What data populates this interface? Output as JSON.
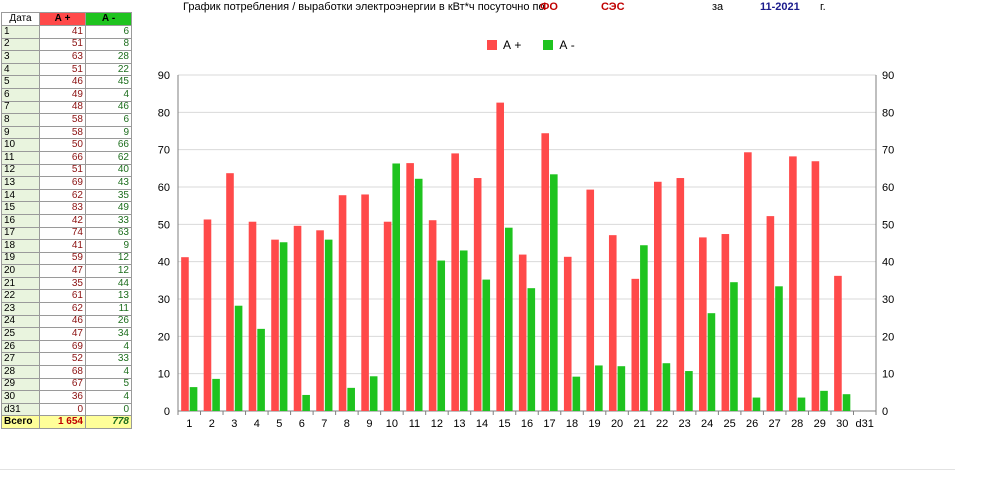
{
  "header": {
    "title": "График потребления / выработки электроэнергии в кВт*ч  посуточно по",
    "fo": "ФО",
    "ses": "СЭС",
    "za": "за",
    "period": "11-2021",
    "g": "г."
  },
  "table": {
    "headers": {
      "date": "Дата",
      "plus": "А +",
      "minus": "А -"
    },
    "rows": [
      {
        "date": "1",
        "plus": "41",
        "minus": "6"
      },
      {
        "date": "2",
        "plus": "51",
        "minus": "8"
      },
      {
        "date": "3",
        "plus": "63",
        "minus": "28"
      },
      {
        "date": "4",
        "plus": "51",
        "minus": "22"
      },
      {
        "date": "5",
        "plus": "46",
        "minus": "45"
      },
      {
        "date": "6",
        "plus": "49",
        "minus": "4"
      },
      {
        "date": "7",
        "plus": "48",
        "minus": "46"
      },
      {
        "date": "8",
        "plus": "58",
        "minus": "6"
      },
      {
        "date": "9",
        "plus": "58",
        "minus": "9"
      },
      {
        "date": "10",
        "plus": "50",
        "minus": "66"
      },
      {
        "date": "11",
        "plus": "66",
        "minus": "62"
      },
      {
        "date": "12",
        "plus": "51",
        "minus": "40"
      },
      {
        "date": "13",
        "plus": "69",
        "minus": "43"
      },
      {
        "date": "14",
        "plus": "62",
        "minus": "35"
      },
      {
        "date": "15",
        "plus": "83",
        "minus": "49"
      },
      {
        "date": "16",
        "plus": "42",
        "minus": "33"
      },
      {
        "date": "17",
        "plus": "74",
        "minus": "63"
      },
      {
        "date": "18",
        "plus": "41",
        "minus": "9"
      },
      {
        "date": "19",
        "plus": "59",
        "minus": "12"
      },
      {
        "date": "20",
        "plus": "47",
        "minus": "12"
      },
      {
        "date": "21",
        "plus": "35",
        "minus": "44"
      },
      {
        "date": "22",
        "plus": "61",
        "minus": "13"
      },
      {
        "date": "23",
        "plus": "62",
        "minus": "11"
      },
      {
        "date": "24",
        "plus": "46",
        "minus": "26"
      },
      {
        "date": "25",
        "plus": "47",
        "minus": "34"
      },
      {
        "date": "26",
        "plus": "69",
        "minus": "4"
      },
      {
        "date": "27",
        "plus": "52",
        "minus": "33"
      },
      {
        "date": "28",
        "plus": "68",
        "minus": "4"
      },
      {
        "date": "29",
        "plus": "67",
        "minus": "5"
      },
      {
        "date": "30",
        "plus": "36",
        "minus": "4"
      },
      {
        "date": "d31",
        "plus": "0",
        "minus": "0"
      }
    ],
    "total": {
      "date": "Всего",
      "plus": "1 654",
      "minus": "778"
    }
  },
  "colors": {
    "plus": "#ff4a4a",
    "minus": "#1fc31f",
    "grid": "#d9d9d9",
    "axis": "#7f7f7f"
  },
  "chart_data": {
    "type": "bar",
    "categories": [
      "1",
      "2",
      "3",
      "4",
      "5",
      "6",
      "7",
      "8",
      "9",
      "10",
      "11",
      "12",
      "13",
      "14",
      "15",
      "16",
      "17",
      "18",
      "19",
      "20",
      "21",
      "22",
      "23",
      "24",
      "25",
      "26",
      "27",
      "28",
      "29",
      "30",
      "d31"
    ],
    "series": [
      {
        "name": "А +",
        "values": [
          41.2,
          51.3,
          63.7,
          50.7,
          45.9,
          49.6,
          48.4,
          57.8,
          58.0,
          50.7,
          66.4,
          51.1,
          69.0,
          62.4,
          82.6,
          41.9,
          74.4,
          41.3,
          59.3,
          47.1,
          35.4,
          61.4,
          62.4,
          46.5,
          47.4,
          69.3,
          52.2,
          68.2,
          66.9,
          36.2,
          0
        ]
      },
      {
        "name": "А -",
        "values": [
          6.4,
          8.6,
          28.2,
          22.0,
          45.2,
          4.3,
          45.9,
          6.2,
          9.3,
          66.3,
          62.2,
          40.3,
          43.0,
          35.2,
          49.1,
          32.9,
          63.4,
          9.2,
          12.2,
          12.0,
          44.4,
          12.8,
          10.7,
          26.2,
          34.5,
          3.6,
          33.4,
          3.6,
          5.4,
          4.5,
          0
        ]
      }
    ],
    "y_ticks": [
      0,
      10,
      20,
      30,
      40,
      50,
      60,
      70,
      80,
      90
    ],
    "ylim": [
      0,
      90
    ],
    "grid": true,
    "legend_position": "top-center",
    "secondary_y_axis": true
  }
}
